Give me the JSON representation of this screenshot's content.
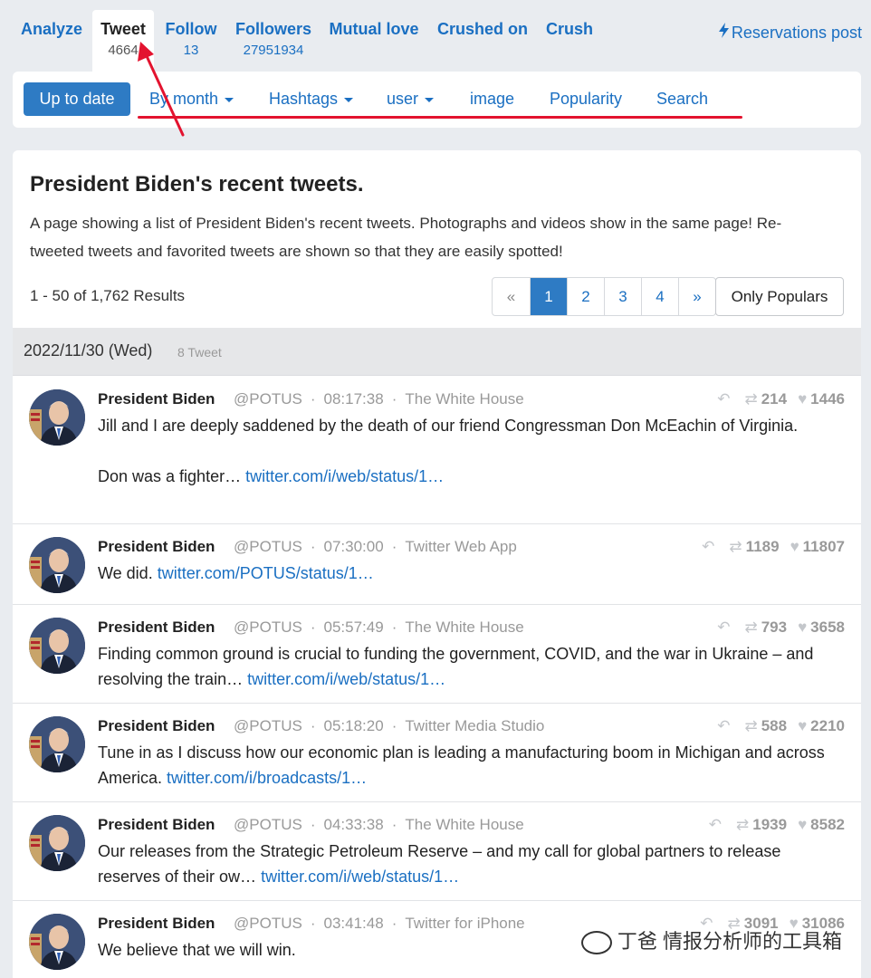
{
  "tabs": [
    {
      "label": "Analyze",
      "count": ""
    },
    {
      "label": "Tweet",
      "count": "4664"
    },
    {
      "label": "Follow",
      "count": "13"
    },
    {
      "label": "Followers",
      "count": "27951934"
    },
    {
      "label": "Mutual love",
      "count": ""
    },
    {
      "label": "Crushed on",
      "count": ""
    },
    {
      "label": "Crush",
      "count": ""
    }
  ],
  "reservations": "Reservations post",
  "subnav": {
    "up_to_date": "Up to date",
    "by_month": "By month",
    "hashtags": "Hashtags",
    "user": "user",
    "image": "image",
    "popularity": "Popularity",
    "search": "Search"
  },
  "main": {
    "title": "President Biden's recent tweets.",
    "description": "A page showing a list of President Biden's recent tweets. Photographs and videos show in the same page! Re-tweeted tweets and favorited tweets are shown so that they are easily spotted!",
    "results": "1 - 50 of 1,762 Results",
    "pager": [
      "«",
      "1",
      "2",
      "3",
      "4",
      "»"
    ],
    "pager_active": "1",
    "only_popular": "Only Populars",
    "day_date": "2022/11/30 (Wed)",
    "day_count": "8 Tweet"
  },
  "tweets": [
    {
      "name": "President Biden",
      "handle": "@POTUS",
      "time": "08:17:38",
      "source": "The White House",
      "retweets": "214",
      "likes": "1446",
      "text": "Jill and I are deeply saddened by the death of our friend Congressman Don McEachin of Virginia.\n\nDon was a fighter… ",
      "link": "twitter.com/i/web/status/1…"
    },
    {
      "name": "President Biden",
      "handle": "@POTUS",
      "time": "07:30:00",
      "source": "Twitter Web App",
      "retweets": "1189",
      "likes": "11807",
      "text": "We did. ",
      "link": "twitter.com/POTUS/status/1…"
    },
    {
      "name": "President Biden",
      "handle": "@POTUS",
      "time": "05:57:49",
      "source": "The White House",
      "retweets": "793",
      "likes": "3658",
      "text": "Finding common ground is crucial to funding the government, COVID, and the war in Ukraine – and resolving the train… ",
      "link": "twitter.com/i/web/status/1…"
    },
    {
      "name": "President Biden",
      "handle": "@POTUS",
      "time": "05:18:20",
      "source": "Twitter Media Studio",
      "retweets": "588",
      "likes": "2210",
      "text": "Tune in as I discuss how our economic plan is leading a manufacturing boom in Michigan and across America. ",
      "link": "twitter.com/i/broadcasts/1…"
    },
    {
      "name": "President Biden",
      "handle": "@POTUS",
      "time": "04:33:38",
      "source": "The White House",
      "retweets": "1939",
      "likes": "8582",
      "text": "Our releases from the Strategic Petroleum Reserve – and my call for global partners to release reserves of their ow… ",
      "link": "twitter.com/i/web/status/1…"
    },
    {
      "name": "President Biden",
      "handle": "@POTUS",
      "time": "03:41:48",
      "source": "Twitter for iPhone",
      "retweets": "3091",
      "likes": "31086",
      "text": "We believe that we will win.",
      "link": ""
    }
  ],
  "watermark": "丁爸 情报分析师的工具箱",
  "icons": {
    "reply": "reply-icon",
    "retweet": "retweet-icon",
    "like": "heart-icon",
    "bolt": "bolt-icon"
  },
  "colors": {
    "link": "#1a6fc2",
    "primary_button": "#2e7bc4",
    "annotation": "#e3132f"
  }
}
